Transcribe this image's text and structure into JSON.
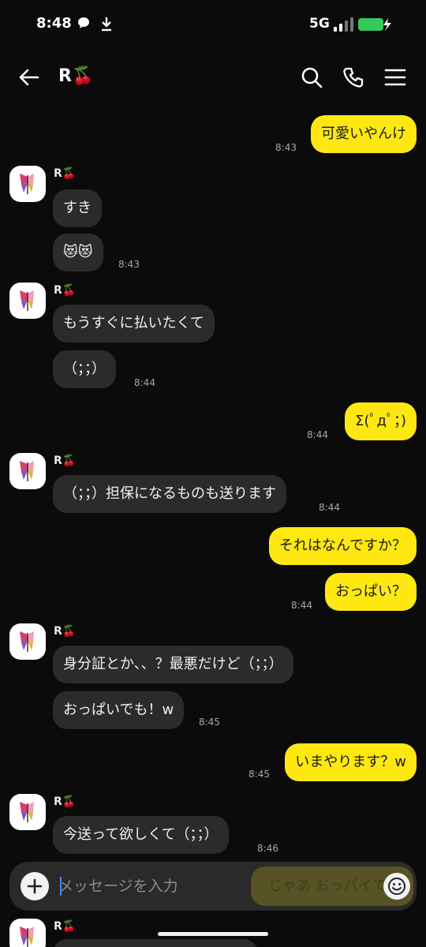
{
  "status_bar": {
    "time": "8:48",
    "network": "5G"
  },
  "header": {
    "title": "R🍒"
  },
  "messages": [
    {
      "text": "可愛いやんけ",
      "time": "8:43"
    },
    {
      "sender": "R🍒",
      "text": "すき"
    },
    {
      "text": "😻😻",
      "time": "8:43"
    },
    {
      "sender": "R🍒",
      "text": "もうすぐに払いたくて"
    },
    {
      "text": "（；；）",
      "time": "8:44"
    },
    {
      "text": "Σ(ﾟдﾟ；)",
      "time": "8:44"
    },
    {
      "sender": "R🍒",
      "text": "（；；）担保になるものも送ります",
      "time": "8:44"
    },
    {
      "text": "それはなんですか？"
    },
    {
      "text": "おっぱい？",
      "time": "8:44"
    },
    {
      "sender": "R🍒",
      "text": "身分証とか、、？最悪だけど（；；）"
    },
    {
      "text": "おっぱいでも！w",
      "time": "8:45"
    },
    {
      "text": "いまやります？w",
      "time": "8:45"
    },
    {
      "sender": "R🍒",
      "text": "今送って欲しくて（；；）",
      "time": "8:46"
    },
    {
      "sender": "R🍒"
    }
  ],
  "composer": {
    "placeholder": "メッセージを入力",
    "suggestion": "じゃあ おっパイで"
  },
  "colors": {
    "my_bubble": "#ffe812",
    "their_bubble": "#2b2b2b",
    "background": "#0b0b0b"
  }
}
